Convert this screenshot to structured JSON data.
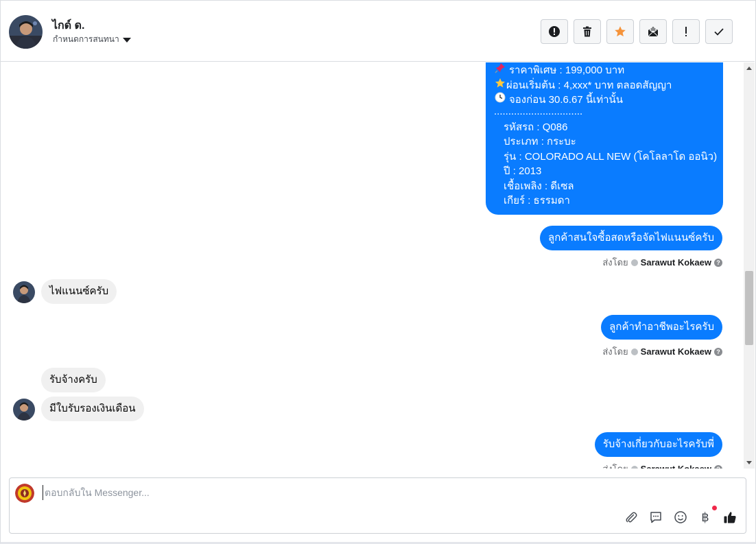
{
  "header": {
    "contact_name": "ไกด์ ด.",
    "assign_label": "กำหนดการสนทนา",
    "actions": [
      "spam-report",
      "delete",
      "star",
      "mark-unread",
      "follow-up",
      "mark-done"
    ]
  },
  "messages": {
    "product_lines": [
      {
        "icon": "pushpin",
        "text": "ราคาพิเศษ : 199,000 บาท"
      },
      {
        "icon": "star",
        "text": "ผ่อนเริ่มต้น : 4,xxx* บาท ตลอดสัญญา"
      },
      {
        "icon": "clock",
        "text": "จองก่อน 30.6.67 นี้เท่านั้น"
      },
      {
        "icon": "",
        "text": "..............................."
      },
      {
        "icon": "",
        "text": "รหัสรถ : Q086"
      },
      {
        "icon": "",
        "text": "ประเภท : กระบะ"
      },
      {
        "icon": "",
        "text": "รุ่น : COLORADO ALL NEW (โคโลลาโด ออนิว)"
      },
      {
        "icon": "",
        "text": "ปี : 2013"
      },
      {
        "icon": "",
        "text": "เชื้อเพลิง : ดีเซล"
      },
      {
        "icon": "",
        "text": "เกียร์ : ธรรมดา"
      }
    ],
    "out_1": "ลูกค้าสนใจซื้อสดหรือจัดไฟแนนซ์ครับ",
    "in_1": "ไฟแนนซ์ครับ",
    "out_2": "ลูกค้าทำอาชีพอะไรครับ",
    "in_2": "รับจ้างครับ",
    "in_3": "มีใบรับรองเงินเดือน",
    "out_3": "รับจ้างเกี่ยวกับอะไรครับพี่",
    "sent_by_label": "ส่งโดย",
    "sender_name": "Sarawut Kokaew"
  },
  "composer": {
    "placeholder": "ตอบกลับใน Messenger..."
  },
  "colors": {
    "outgoing_bubble": "#0a7cff",
    "incoming_bubble": "#f0f0f0",
    "star_accent": "#f5933a",
    "notification_dot": "#f02849"
  }
}
